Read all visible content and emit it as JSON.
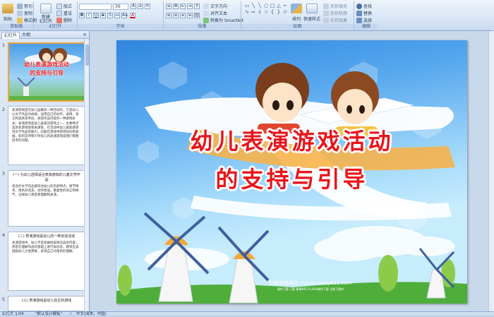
{
  "ribbon": {
    "clipboard": {
      "label": "剪贴板",
      "paste": "粘贴",
      "cut": "剪切",
      "copy": "复制",
      "format_painter": "格式刷"
    },
    "slides": {
      "label": "幻灯片",
      "new_slide": "新建\n幻灯片",
      "layout": "版式",
      "reset": "重设",
      "delete": "删除"
    },
    "font": {
      "label": "字体",
      "size": "36"
    },
    "paragraph": {
      "label": "段落",
      "text_direction": "文字方向",
      "align_text": "对齐文本",
      "smartart": "转换为 SmartArt"
    },
    "drawing": {
      "label": "绘图",
      "arrange": "排列",
      "quick_styles": "快速样式",
      "shape_fill": "形状填充",
      "shape_outline": "形状轮廓",
      "shape_effects": "形状效果"
    },
    "editing": {
      "label": "编辑",
      "find": "查找",
      "replace": "替换",
      "select": "选择"
    }
  },
  "left_panel": {
    "tab_slides": "幻灯片",
    "tab_outline": "大纲",
    "close": "×",
    "slides": [
      {
        "num": "1",
        "title_line1": "幼儿表演游戏活动",
        "title_line2": "的支持与引导"
      },
      {
        "num": "2",
        "text": "表演游戏是在幼儿园最初一种活动的，它是幼儿以文学作品为依据，运用自己的动作、表情、语言和道具等手段，再现作品内容的一种游戏形式，表演游戏是幼儿喜爱的游戏之一，主要特点是具有游戏性和表演性，在活动中幼儿既能感受到文学作品的魅力，也能在游戏中获得快乐和发展，如何支持和引导幼儿的表演游戏是我们需要思考的问题。"
      },
      {
        "num": "3",
        "heading": "(一) 为幼儿选择适合表演游戏的儿童文学作品",
        "text": "适合的文学作品要符合幼儿的年龄特点，情节简单，角色对话多，动作性强，重复性的语言和情节，这样幼儿更容易理解和表演。"
      },
      {
        "num": "4",
        "heading": "(二) 表演游戏是幼儿的一种创造活动",
        "text": "表演游戏中，幼儿不是机械地再现作品的内容，而是在理解作品的基础上进行再创造，教师应该鼓励幼儿大胆想象，表现自己对角色的理解。"
      },
      {
        "num": "5",
        "heading": "(三) 表演游戏是幼儿自主的游戏"
      }
    ]
  },
  "slide": {
    "title_line1": "幼儿表演游戏活动",
    "title_line2": "的支持与引导",
    "credit_main": "幼教资源网站 ziyuan.baby611.com",
    "credit_sub": "课件下载  儿歌  故事MP3  FLASH课件下载  试卷下载库"
  },
  "status": {
    "slide_count": "幻灯片 1/34",
    "theme": "\"默认设计模板\"",
    "language": "中文(简体，中国)"
  },
  "colors": {
    "title_red": "#e8161b",
    "selection_orange": "#f2a33a",
    "ribbon_blue": "#d6e4f5"
  }
}
